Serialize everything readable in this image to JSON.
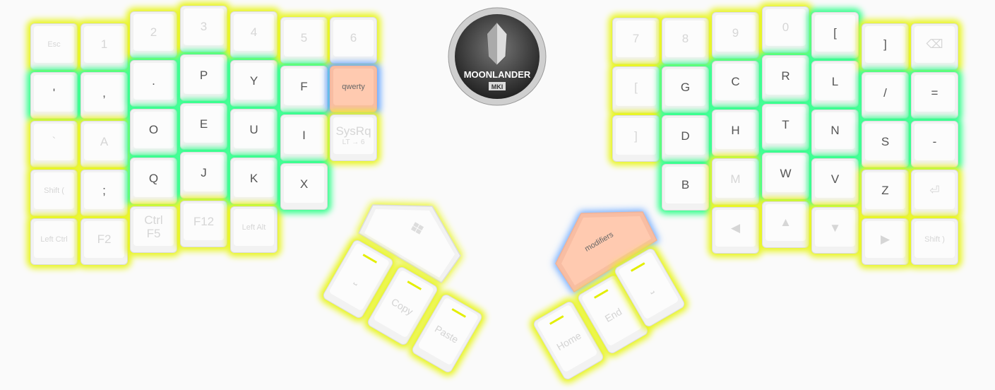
{
  "colors": {
    "yellow_glow": "#e8f51e",
    "green_glow": "#33ff8c",
    "blue_glow": "#6aa8ff",
    "highlight": "#ffcab0"
  },
  "logo": {
    "title": "MOONLANDER",
    "subtitle": "MKI"
  },
  "left": [
    [
      {
        "l": "Esc",
        "s": 1
      },
      {
        "l": "'",
        "a": 1,
        "g": "green"
      },
      {
        "l": "`"
      },
      {
        "l": "Shift (",
        "s": 1
      },
      {
        "l": "Left Ctrl",
        "s": 1
      }
    ],
    [
      {
        "l": "1"
      },
      {
        "l": ",",
        "a": 1,
        "g": "green"
      },
      {
        "l": "A"
      },
      {
        "l": ";",
        "a": 1
      },
      {
        "l": "F2"
      }
    ],
    [
      {
        "l": "2"
      },
      {
        "l": ".",
        "a": 1,
        "g": "green"
      },
      {
        "l": "O",
        "a": 1,
        "g": "green"
      },
      {
        "l": "Q",
        "a": 1,
        "g": "green"
      },
      {
        "l": "Ctrl",
        "sub": "F5"
      }
    ],
    [
      {
        "l": "3"
      },
      {
        "l": "P",
        "a": 1,
        "g": "green"
      },
      {
        "l": "E",
        "a": 1,
        "g": "green"
      },
      {
        "l": "J",
        "a": 1,
        "g": "green"
      },
      {
        "l": "F12"
      }
    ],
    [
      {
        "l": "4"
      },
      {
        "l": "Y",
        "a": 1,
        "g": "green"
      },
      {
        "l": "U",
        "a": 1,
        "g": "green"
      },
      {
        "l": "K",
        "a": 1,
        "g": "green"
      },
      {
        "l": "Left Alt",
        "s": 1
      }
    ],
    [
      {
        "l": "5"
      },
      {
        "l": "F",
        "a": 1,
        "g": "green"
      },
      {
        "l": "I",
        "a": 1,
        "g": "green"
      },
      {
        "l": "X",
        "a": 1,
        "g": "green"
      }
    ],
    [
      {
        "l": "6"
      },
      {
        "l": "qwerty",
        "hl": 1
      },
      {
        "l": "SysRq",
        "sub": "LT → 6"
      }
    ]
  ],
  "right": [
    [
      {
        "l": "7"
      },
      {
        "l": "["
      },
      {
        "l": "]"
      }
    ],
    [
      {
        "l": "8"
      },
      {
        "l": "G",
        "a": 1,
        "g": "green"
      },
      {
        "l": "D",
        "a": 1,
        "g": "green"
      },
      {
        "l": "B",
        "a": 1,
        "g": "green"
      }
    ],
    [
      {
        "l": "9"
      },
      {
        "l": "C",
        "a": 1,
        "g": "green"
      },
      {
        "l": "H",
        "a": 1,
        "g": "green"
      },
      {
        "l": "M"
      },
      {
        "l": "◀"
      }
    ],
    [
      {
        "l": "0"
      },
      {
        "l": "R",
        "a": 1,
        "g": "green"
      },
      {
        "l": "T",
        "a": 1,
        "g": "green"
      },
      {
        "l": "W",
        "a": 1,
        "g": "green"
      },
      {
        "l": "▲"
      }
    ],
    [
      {
        "l": "[",
        "a": 1,
        "g": "green"
      },
      {
        "l": "L",
        "a": 1,
        "g": "green"
      },
      {
        "l": "N",
        "a": 1,
        "g": "green"
      },
      {
        "l": "V",
        "a": 1,
        "g": "green"
      },
      {
        "l": "▼"
      }
    ],
    [
      {
        "l": "]",
        "a": 1
      },
      {
        "l": "/",
        "a": 1,
        "g": "green"
      },
      {
        "l": "S",
        "a": 1,
        "g": "green"
      },
      {
        "l": "Z",
        "a": 1
      },
      {
        "l": "▶"
      }
    ],
    [
      {
        "l": "⌫"
      },
      {
        "l": "=",
        "a": 1,
        "g": "green"
      },
      {
        "l": "-",
        "a": 1,
        "g": "green"
      },
      {
        "l": "⏎"
      },
      {
        "l": "Shift )",
        "s": 1
      }
    ]
  ],
  "thumbs": {
    "left_big": "windows-icon",
    "left": [
      "⎵",
      "Copy",
      "Paste"
    ],
    "right_big": "modifiers",
    "right": [
      "Home",
      "End",
      "⎵"
    ]
  }
}
